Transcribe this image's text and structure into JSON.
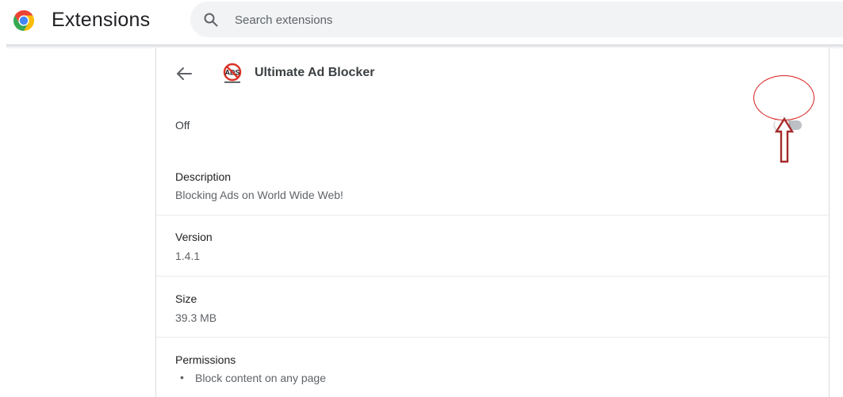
{
  "header": {
    "title": "Extensions",
    "search_placeholder": "Search extensions"
  },
  "extension": {
    "name": "Ultimate Ad Blocker",
    "icon_text": "ADS",
    "status": "Off",
    "enabled": false
  },
  "details": {
    "description_label": "Description",
    "description_value": "Blocking Ads on World Wide Web!",
    "version_label": "Version",
    "version_value": "1.4.1",
    "size_label": "Size",
    "size_value": "39.3 MB",
    "permissions_label": "Permissions",
    "permissions": [
      "Block content on any page"
    ]
  },
  "icons": {
    "logo": "chrome-logo-icon",
    "search": "search-icon",
    "back": "arrow-left-icon",
    "extension": "no-ads-icon"
  },
  "colors": {
    "annotation": "#d81e1e",
    "arrow": "#a52a2a",
    "toggle_off_track": "#bdc1c6",
    "search_bg": "#f1f3f4"
  }
}
